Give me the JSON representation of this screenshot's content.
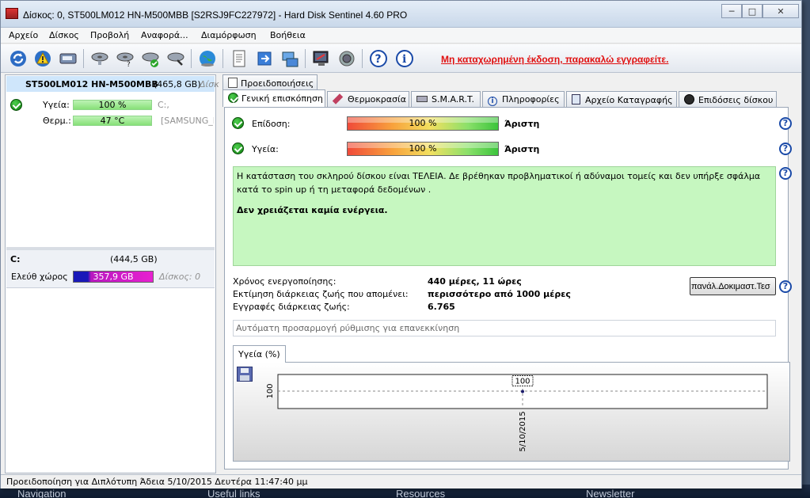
{
  "window": {
    "title": "Δίσκος: 0, ST500LM012 HN-M500MBB [S2RSJ9FC227972]  -  Hard Disk Sentinel 4.60 PRO",
    "controls": {
      "minimize": "─",
      "maximize": "□",
      "close": "✕"
    }
  },
  "menu": [
    "Αρχείο",
    "Δίσκος",
    "Προβολή",
    "Αναφορά...",
    "Διαμόρφωση",
    "Βοήθεια"
  ],
  "toolbar": {
    "register_link": "Μη καταχωρημένη έκδοση, παρακαλώ εγγραφείτε."
  },
  "disk": {
    "name": "ST500LM012 HN-M500MBB",
    "size": "(465,8 GB)",
    "index_label": "Δίσκ",
    "health_label": "Υγεία:",
    "health_value": "100 %",
    "health_fraction": 1.0,
    "temp_label": "Θερμ.:",
    "temp_value": "47 °C",
    "drive_letter": "C:,",
    "vendor": "[SAMSUNG_F"
  },
  "volume": {
    "letter": "C:",
    "size": "(444,5 GB)",
    "free_label": "Ελεύθ χώρος",
    "free_value": "357,9 GB",
    "disk_ref": "Δίσκος: 0"
  },
  "tabs": {
    "upper": [
      "Προειδοποιήσεις"
    ],
    "lower": [
      "Γενική επισκόπηση",
      "Θερμοκρασία",
      "S.M.A.R.T.",
      "Πληροφορίες",
      "Αρχείο Καταγραφής",
      "Επιδόσεις δίσκου"
    ]
  },
  "overview": {
    "performance_label": "Επίδοση:",
    "performance_value": "100 %",
    "performance_fraction": 1.0,
    "performance_rating": "Άριστη",
    "health_label": "Υγεία:",
    "health_value": "100 %",
    "health_fraction": 1.0,
    "health_rating": "Άριστη",
    "status_text": "Η κατάσταση του σκληρού δίσκου είναι ΤΕΛΕΙΑ. Δε βρέθηκαν προβληματικοί ή αδύναμοι τομείς και δεν υπήρξε σφάλμα κατά το spin up ή τη μεταφορά δεδομένων .",
    "action_text": "Δεν χρειάζεται καμία ενέργεια.",
    "power_on_label": "Χρόνος ενεργοποίησης:",
    "power_on_value": "440 μέρες, 11 ώρες",
    "lifetime_label": "Εκτίμηση διάρκειας ζωής που απομένει:",
    "lifetime_value": "περισσότερο από 1000 μέρες",
    "lifetime_writes_label": "Εγγραφές διάρκειας ζωής:",
    "lifetime_writes_value": "6.765",
    "test_button": "πανάλ.Δοκιμαστ.Τεσ",
    "auto_field": "Αυτόματη προσαρμογή ρύθμισης για επανεκκίνηση"
  },
  "chart_data": {
    "type": "line",
    "tab_title": "Υγεία (%)",
    "series": [
      {
        "values": [
          100
        ]
      }
    ],
    "x": [
      "5/10/2015"
    ],
    "ytick": "100",
    "data_label": "100"
  },
  "statusbar": "Προειδοποίηση για Διπλότυπη  Άδεια 5/10/2015 Δευτέρα 11:47:40 μμ",
  "background": {
    "items": [
      "Navigation",
      "Useful links",
      "Resources",
      "Newsletter"
    ]
  }
}
